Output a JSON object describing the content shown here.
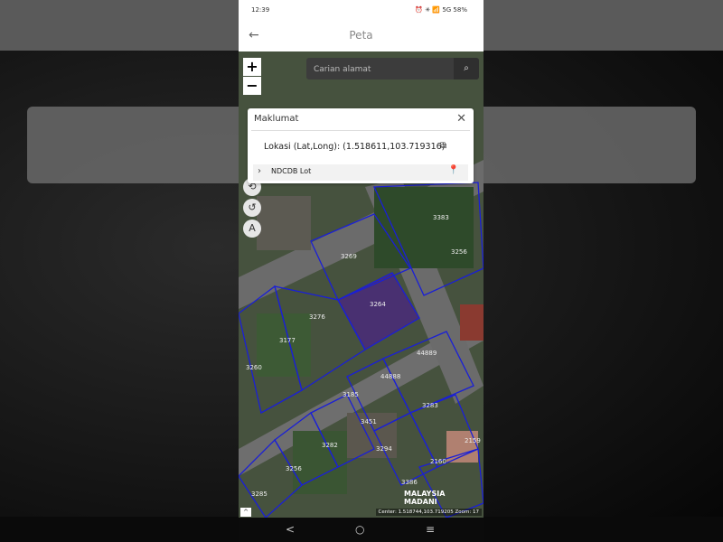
{
  "status_bar": {
    "time": "12:39",
    "right_icons": "⏰ ✳ 📶 5G 58%"
  },
  "app_bar": {
    "title": "Peta"
  },
  "search": {
    "placeholder": "Carian alamat"
  },
  "zoom": {
    "in_label": "+",
    "out_label": "−"
  },
  "popup": {
    "title": "Maklumat",
    "location_text": "Lokasi (Lat,Long): (1.518611,103.719316)",
    "item_label": "NDCDB Lot"
  },
  "map_labels": [
    "3383",
    "3256",
    "3269",
    "3264",
    "3276",
    "3177",
    "3260",
    "44889",
    "44888",
    "3185",
    "3451",
    "3283",
    "3282",
    "3294",
    "2159",
    "2160",
    "3285",
    "3386",
    "3256"
  ],
  "map_status": "Center: 1.518744,103.719205  Zoom: 17",
  "logo_text": {
    "line1": "MALAYSIA",
    "line2": "MADANI"
  },
  "nav_bar": {
    "back": "<",
    "home": "○",
    "recent": "≡"
  },
  "icons": [
    "back-arrow-icon",
    "search-icon",
    "close-icon",
    "copy-icon",
    "chevron-right-icon",
    "pin-icon",
    "layers-icon",
    "measure-icon",
    "rotate-icon",
    "text-icon"
  ],
  "colors": {
    "lot_border": "#1a1fd6",
    "selected_lot": "#4a2a7a"
  }
}
